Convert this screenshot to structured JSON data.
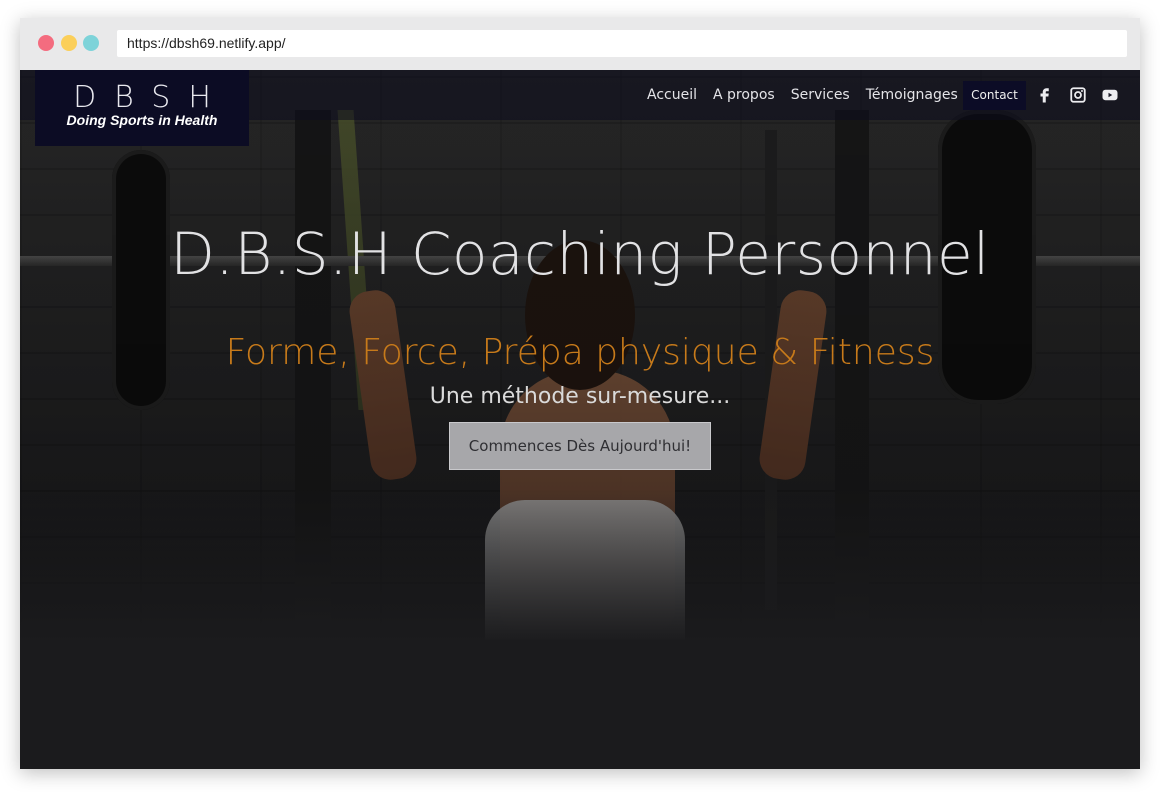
{
  "browser": {
    "url": "https://dbsh69.netlify.app/"
  },
  "brand": {
    "letters": "DBSH",
    "tagline": "Doing Sports in Health"
  },
  "nav": {
    "links": [
      "Accueil",
      "A propos",
      "Services",
      "Témoignages"
    ],
    "contact": "Contact",
    "social_icons": [
      "facebook-icon",
      "instagram-icon",
      "youtube-icon"
    ]
  },
  "hero": {
    "title": "D.B.S.H Coaching Personnel",
    "subtitle": "Forme, Force, Prépa physique & Fitness",
    "tagline": "Une méthode sur-mesure...",
    "cta": "Commences Dès Aujourd'hui!"
  },
  "colors": {
    "accent": "#c77a1a",
    "navy": "#0c0c24",
    "background": "#1b1b1d"
  }
}
